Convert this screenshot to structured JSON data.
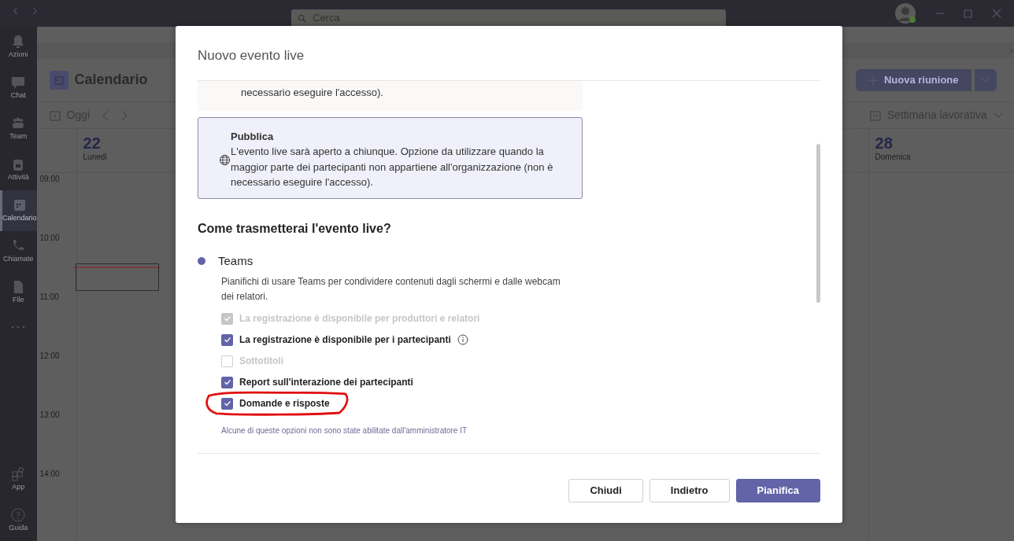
{
  "title_bar": {
    "search_placeholder": "Cerca"
  },
  "app_rail": {
    "items": [
      {
        "label": "Azioni",
        "selected": false
      },
      {
        "label": "Chat",
        "selected": false
      },
      {
        "label": "Team",
        "selected": false
      },
      {
        "label": "Attività",
        "selected": false
      },
      {
        "label": "Calendario",
        "selected": true
      },
      {
        "label": "Chiamate",
        "selected": false
      },
      {
        "label": "File",
        "selected": false
      }
    ],
    "bottom_items": [
      {
        "label": "App"
      },
      {
        "label": "Guida"
      }
    ]
  },
  "calendar": {
    "title": "Calendario",
    "today": "Oggi",
    "new_meeting": "Nuova riunione",
    "view": "Settimana lavorativa",
    "days": [
      {
        "number": "22",
        "name": "Lunedì"
      },
      {
        "number": "28",
        "name": "Domenica"
      }
    ],
    "hours": [
      "09:00",
      "10:00",
      "11:00",
      "12:00",
      "13:00",
      "14:00"
    ]
  },
  "dialog": {
    "title": "Nuovo evento live",
    "options": [
      {
        "description": "necessario eseguire l'accesso).",
        "selected": false
      },
      {
        "title": "Pubblica",
        "description": "L'evento live sarà aperto a chiunque. Opzione da utilizzare quando la maggior parte dei partecipanti non appartiene all'organizzazione (non è necessario eseguire l'accesso).",
        "selected": true
      }
    ],
    "section_heading": "Come trasmetterai l'evento live?",
    "method": {
      "label": "Teams",
      "selected": true,
      "description": "Pianifichi di usare Teams per condividere contenuti dagli schermi e dalle webcam dei relatori."
    },
    "checkboxes": [
      {
        "label": "La registrazione è disponibile per produttori e relatori",
        "checked": true,
        "disabled": true,
        "info": false
      },
      {
        "label": "La registrazione è disponibile per i partecipanti",
        "checked": true,
        "disabled": false,
        "info": true
      },
      {
        "label": "Sottotitoli",
        "checked": false,
        "disabled": true,
        "info": false
      },
      {
        "label": "Report sull'interazione dei partecipanti",
        "checked": true,
        "disabled": false,
        "info": false
      },
      {
        "label": "Domande e risposte",
        "checked": true,
        "disabled": false,
        "info": false
      }
    ],
    "note": "Alcune di queste opzioni non sono state abilitate dall'amministratore IT",
    "buttons": [
      {
        "label": "Chiudi",
        "kind": "secondary"
      },
      {
        "label": "Indietro",
        "kind": "secondary"
      },
      {
        "label": "Pianifica",
        "kind": "primary"
      }
    ]
  }
}
